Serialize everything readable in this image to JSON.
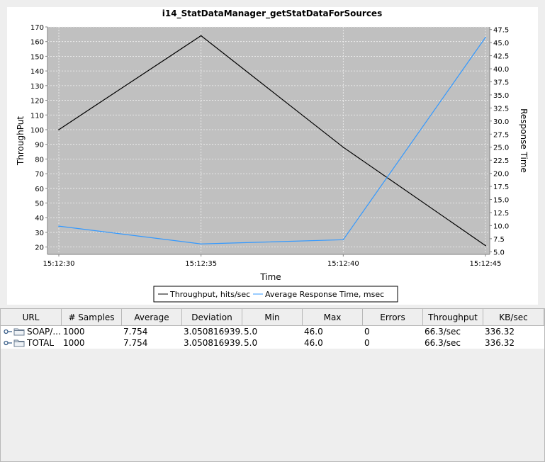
{
  "chart_data": {
    "type": "line",
    "title": "i14_StatDataManager_getStatDataForSources",
    "xlabel": "Time",
    "ylabel": "ThroughPut",
    "y2label": "Response Time",
    "categories": [
      "15:12:30",
      "15:12:35",
      "15:12:40",
      "15:12:45"
    ],
    "ylim": [
      15,
      170
    ],
    "yticks": [
      20,
      30,
      40,
      50,
      60,
      70,
      80,
      90,
      100,
      110,
      120,
      130,
      140,
      150,
      160,
      170
    ],
    "y2lim": [
      4.5,
      48.0
    ],
    "y2ticks": [
      "5.0",
      "7.5",
      "10.0",
      "12.5",
      "15.0",
      "17.5",
      "20.0",
      "22.5",
      "25.0",
      "27.5",
      "30.0",
      "32.5",
      "35.0",
      "37.5",
      "40.0",
      "42.5",
      "45.0",
      "47.5"
    ],
    "grid": true,
    "legend_position": "bottom",
    "series": [
      {
        "name": "Throughput, hits/sec",
        "axis": "left",
        "color": "#000000",
        "values": [
          100,
          164,
          88,
          21
        ]
      },
      {
        "name": "Average Response Time, msec",
        "axis": "right",
        "color": "#3399ff",
        "values": [
          9.9,
          6.5,
          7.3,
          46.0
        ]
      }
    ]
  },
  "colors": {
    "plot_background": "#c0c0c0",
    "grid": "#f2f2f2"
  },
  "table": {
    "columns": [
      "URL",
      "# Samples",
      "Average",
      "Deviation",
      "Min",
      "Max",
      "Errors",
      "Throughput",
      "KB/sec"
    ],
    "rows": [
      {
        "icon": "folder-icon",
        "cells": [
          "SOAP/...",
          "1000",
          "7.754",
          "3.050816939...",
          "5.0",
          "46.0",
          "0",
          "66.3/sec",
          "336.32"
        ]
      },
      {
        "icon": "folder-icon",
        "cells": [
          "TOTAL",
          "1000",
          "7.754",
          "3.050816939...",
          "5.0",
          "46.0",
          "0",
          "66.3/sec",
          "336.32"
        ]
      }
    ]
  }
}
